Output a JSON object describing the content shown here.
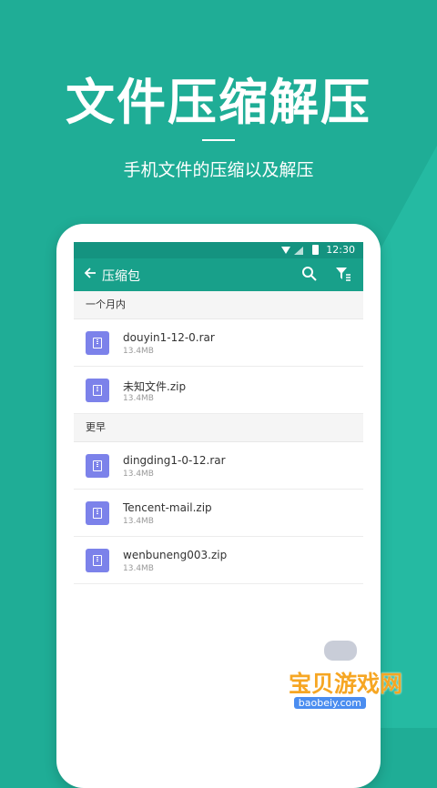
{
  "promo": {
    "headline": "文件压缩解压",
    "subtitle": "手机文件的压缩以及解压"
  },
  "statusbar": {
    "time": "12:30"
  },
  "toolbar": {
    "title": "压缩包",
    "back_icon": "arrow-left-icon",
    "search_icon": "search-icon",
    "filter_icon": "filter-icon"
  },
  "sections": [
    {
      "label": "一个月内",
      "files": [
        {
          "name": "douyin1-12-0.rar",
          "size": "13.4MB"
        },
        {
          "name": "未知文件.zip",
          "size": "13.4MB"
        }
      ]
    },
    {
      "label": "更早",
      "files": [
        {
          "name": "dingding1-0-12.rar",
          "size": "13.4MB"
        },
        {
          "name": "Tencent-mail.zip",
          "size": "13.4MB"
        },
        {
          "name": "wenbuneng003.zip",
          "size": "13.4MB"
        }
      ]
    }
  ],
  "watermark": {
    "text": "宝贝游戏网",
    "url": "baobeiy.com"
  },
  "colors": {
    "background": "#1fad96",
    "toolbar": "#18a08a",
    "statusbar": "#149380",
    "file_icon": "#7c82ea"
  }
}
